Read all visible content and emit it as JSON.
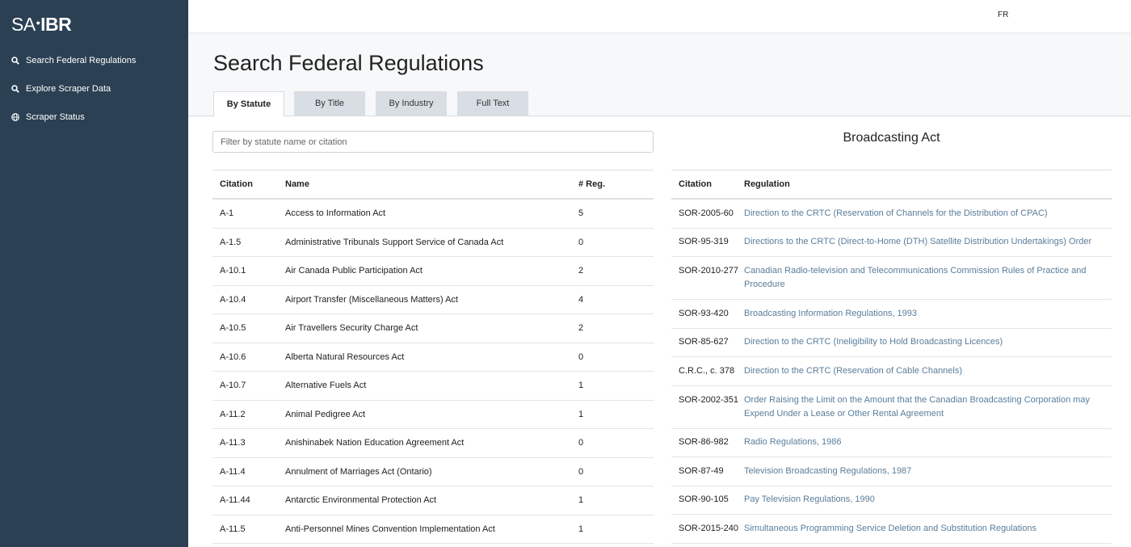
{
  "sidebar": {
    "logo": {
      "left": "SA",
      "right": "IBR"
    },
    "items": [
      {
        "label": "Search Federal Regulations",
        "icon": "search-icon"
      },
      {
        "label": "Explore Scraper Data",
        "icon": "search-icon"
      },
      {
        "label": "Scraper Status",
        "icon": "globe-icon"
      }
    ]
  },
  "topbar": {
    "language": "FR"
  },
  "page": {
    "title": "Search Federal Regulations"
  },
  "tabs": [
    {
      "label": "By Statute",
      "active": true
    },
    {
      "label": "By Title",
      "active": false
    },
    {
      "label": "By Industry",
      "active": false
    },
    {
      "label": "Full Text",
      "active": false
    }
  ],
  "filter": {
    "placeholder": "Filter by statute name or citation",
    "value": ""
  },
  "statutes": {
    "headers": [
      "Citation",
      "Name",
      "# Reg."
    ],
    "rows": [
      [
        "A-1",
        "Access to Information Act",
        "5"
      ],
      [
        "A-1.5",
        "Administrative Tribunals Support Service of Canada Act",
        "0"
      ],
      [
        "A-10.1",
        "Air Canada Public Participation Act",
        "2"
      ],
      [
        "A-10.4",
        "Airport Transfer (Miscellaneous Matters) Act",
        "4"
      ],
      [
        "A-10.5",
        "Air Travellers Security Charge Act",
        "2"
      ],
      [
        "A-10.6",
        "Alberta Natural Resources Act",
        "0"
      ],
      [
        "A-10.7",
        "Alternative Fuels Act",
        "1"
      ],
      [
        "A-11.2",
        "Animal Pedigree Act",
        "1"
      ],
      [
        "A-11.3",
        "Anishinabek Nation Education Agreement Act",
        "0"
      ],
      [
        "A-11.4",
        "Annulment of Marriages Act (Ontario)",
        "0"
      ],
      [
        "A-11.44",
        "Antarctic Environmental Protection Act",
        "1"
      ],
      [
        "A-11.5",
        "Anti-Personnel Mines Convention Implementation Act",
        "1"
      ]
    ]
  },
  "detail": {
    "title": "Broadcasting Act",
    "headers": [
      "Citation",
      "Regulation"
    ],
    "rows": [
      [
        "SOR-2005-60",
        "Direction to the CRTC (Reservation of Channels for the Distribution of CPAC)"
      ],
      [
        "SOR-95-319",
        "Directions to the CRTC (Direct-to-Home (DTH) Satellite Distribution Undertakings) Order"
      ],
      [
        "SOR-2010-277",
        "Canadian Radio-television and Telecommunications Commission Rules of Practice and Procedure"
      ],
      [
        "SOR-93-420",
        "Broadcasting Information Regulations, 1993"
      ],
      [
        "SOR-85-627",
        "Direction to the CRTC (Ineligibility to Hold Broadcasting Licences)"
      ],
      [
        "C.R.C., c. 378",
        "Direction to the CRTC (Reservation of Cable Channels)"
      ],
      [
        "SOR-2002-351",
        "Order Raising the Limit on the Amount that the Canadian Broadcasting Corporation may Expend Under a Lease or Other Rental Agreement"
      ],
      [
        "SOR-86-982",
        "Radio Regulations, 1986"
      ],
      [
        "SOR-87-49",
        "Television Broadcasting Regulations, 1987"
      ],
      [
        "SOR-90-105",
        "Pay Television Regulations, 1990"
      ],
      [
        "SOR-2015-240",
        "Simultaneous Programming Service Deletion and Substitution Regulations"
      ]
    ]
  }
}
